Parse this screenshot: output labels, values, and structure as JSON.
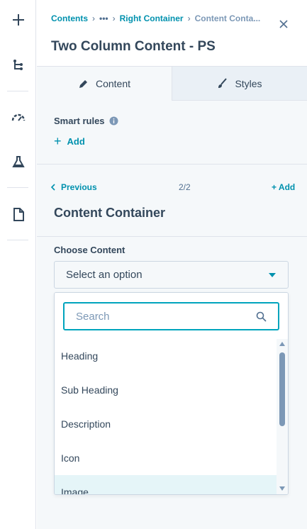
{
  "rail": {
    "items": [
      "add-icon",
      "tree-icon",
      "speedometer-icon",
      "flask-icon",
      "page-icon"
    ]
  },
  "breadcrumb": {
    "items": [
      "Contents",
      "•••",
      "Right Container"
    ],
    "current": "Content Conta..."
  },
  "header": {
    "title": "Two Column Content - PS"
  },
  "tabs": {
    "content": "Content",
    "styles": "Styles"
  },
  "smart_rules": {
    "label": "Smart rules",
    "add_label": "Add"
  },
  "pager": {
    "previous_label": "Previous",
    "page": "2/2",
    "add_label": "+ Add"
  },
  "section": {
    "title": "Content Container"
  },
  "choose_content": {
    "label": "Choose Content",
    "selected": "Select an option",
    "search_placeholder": "Search",
    "options": [
      "Heading",
      "Sub Heading",
      "Description",
      "Icon",
      "Image"
    ],
    "highlighted_index": 4
  },
  "colors": {
    "accent": "#0091ae",
    "text": "#33475b",
    "panel_bg": "#f5f8fa",
    "highlight": "#e5f5f8"
  }
}
